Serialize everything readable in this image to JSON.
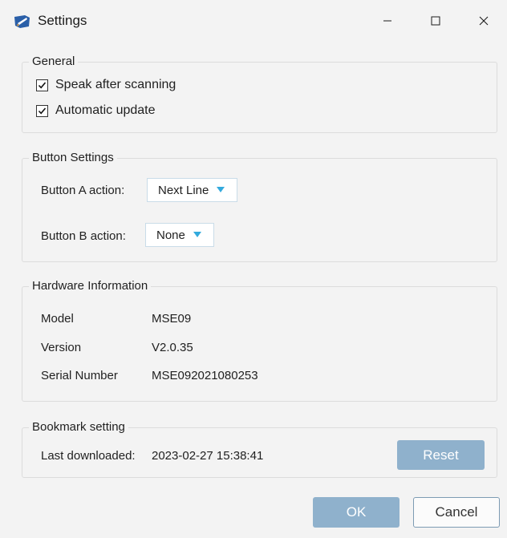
{
  "window": {
    "title": "Settings",
    "icon": "app-icon",
    "controls": [
      "minimize-icon",
      "maximize-icon",
      "close-icon"
    ]
  },
  "general": {
    "label": "General",
    "options": [
      {
        "label": "Speak after scanning",
        "checked": true
      },
      {
        "label": "Automatic update",
        "checked": true
      }
    ]
  },
  "button_settings": {
    "label": "Button Settings",
    "button_a": {
      "label": "Button A action:",
      "value": "Next Line"
    },
    "button_b": {
      "label": "Button B action:",
      "value": "None"
    }
  },
  "hardware": {
    "label": "Hardware Information",
    "rows": [
      {
        "label": "Model",
        "value": "MSE09"
      },
      {
        "label": "Version",
        "value": "V2.0.35"
      },
      {
        "label": "Serial Number",
        "value": "MSE092021080253"
      }
    ]
  },
  "bookmark": {
    "label": "Bookmark setting",
    "last_downloaded_label": "Last downloaded:",
    "last_downloaded_value": "2023-02-27 15:38:41",
    "reset_label": "Reset"
  },
  "footer": {
    "ok_label": "OK",
    "cancel_label": "Cancel"
  },
  "colors": {
    "accent": "#8fb1cc",
    "dropdown_arrow": "#33aadd",
    "window_bg": "#f3f3f3"
  }
}
